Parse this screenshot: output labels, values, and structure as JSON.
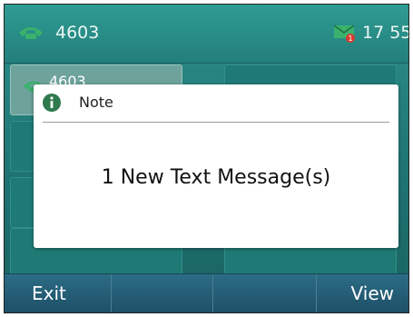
{
  "status": {
    "line_number": "4603",
    "time": "17 55"
  },
  "line_keys": [
    {
      "label": "4603"
    }
  ],
  "dialog": {
    "title": "Note",
    "message": "1 New Text Message(s)"
  },
  "softkeys": {
    "key1": "Exit",
    "key2": "",
    "key3": "",
    "key4": "View"
  },
  "colors": {
    "status_bar": "#2f9c93",
    "softkey_bar": "#2c6c85",
    "accent_green": "#3ab26b",
    "info_icon": "#2f7a4e",
    "badge_red": "#d63b2f"
  },
  "icons": {
    "line_status": "phone-handset-icon",
    "new_message": "envelope-with-badge-icon",
    "dialog": "info-icon"
  }
}
